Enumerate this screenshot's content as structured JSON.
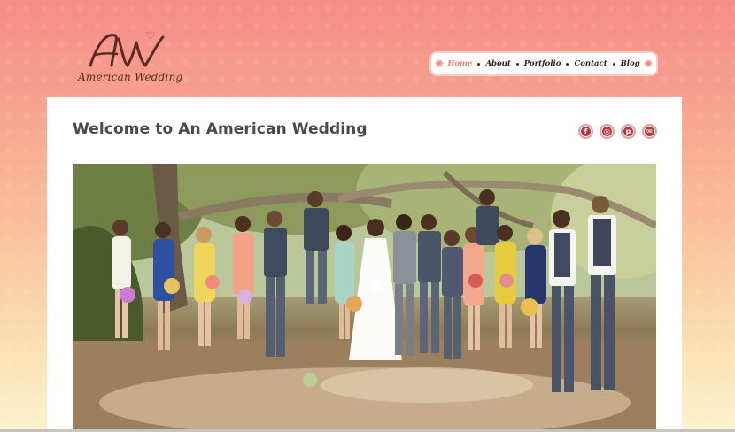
{
  "logo": {
    "monogram": "AW",
    "text": "American Wedding"
  },
  "nav": {
    "items": [
      {
        "label": "Home",
        "active": true
      },
      {
        "label": "About",
        "active": false
      },
      {
        "label": "Portfolio",
        "active": false
      },
      {
        "label": "Contact",
        "active": false
      },
      {
        "label": "Blog",
        "active": false
      }
    ]
  },
  "page": {
    "title": "Welcome to An American Wedding"
  },
  "social": [
    {
      "icon": "facebook-icon",
      "glyph": "f"
    },
    {
      "icon": "dribbble-icon",
      "glyph": "◎"
    },
    {
      "icon": "pinterest-icon",
      "glyph": "p"
    },
    {
      "icon": "email-icon",
      "glyph": "✉"
    }
  ],
  "photo": {
    "alt": "Wedding party group photo under trees"
  },
  "colors": {
    "accent": "#f2796f",
    "social_bg": "#b43a3e",
    "title": "#4a4a4a",
    "logo": "#5a2a1e"
  }
}
